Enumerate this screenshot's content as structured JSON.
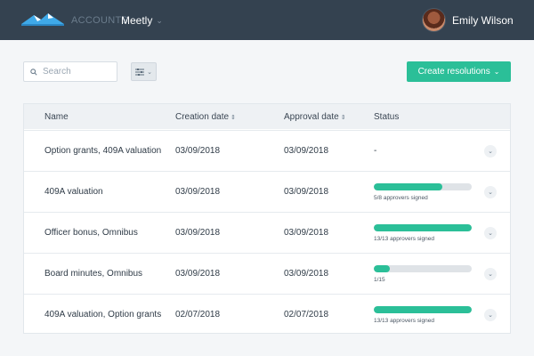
{
  "header": {
    "accounts_label": "ACCOUNTS",
    "company_name": "Meetly",
    "user_name": "Emily Wilson",
    "bg_color": "#344250"
  },
  "toolbar": {
    "search_placeholder": "Search",
    "create_label": "Create resolutions",
    "accent_color": "#2bbf98"
  },
  "table": {
    "columns": [
      "Name",
      "Creation date",
      "Approval date",
      "Status"
    ],
    "rows": [
      {
        "name": "Option grants, 409A valuation",
        "created": "03/09/2018",
        "approved": "03/09/2018",
        "status_text": "-",
        "progress": null,
        "approvers": ""
      },
      {
        "name": "409A valuation",
        "created": "03/09/2018",
        "approved": "03/09/2018",
        "status_text": "",
        "progress": 0.7,
        "approvers": "5/8 approvers signed"
      },
      {
        "name": "Officer bonus, Omnibus",
        "created": "03/09/2018",
        "approved": "03/09/2018",
        "status_text": "",
        "progress": 1.0,
        "approvers": "13/13 approvers signed"
      },
      {
        "name": "Board minutes, Omnibus",
        "created": "03/09/2018",
        "approved": "03/09/2018",
        "status_text": "",
        "progress": 0.16,
        "approvers": "1/15"
      },
      {
        "name": "409A valuation, Option grants",
        "created": "02/07/2018",
        "approved": "02/07/2018",
        "status_text": "",
        "progress": 1.0,
        "approvers": "13/13 approvers signed"
      }
    ]
  }
}
